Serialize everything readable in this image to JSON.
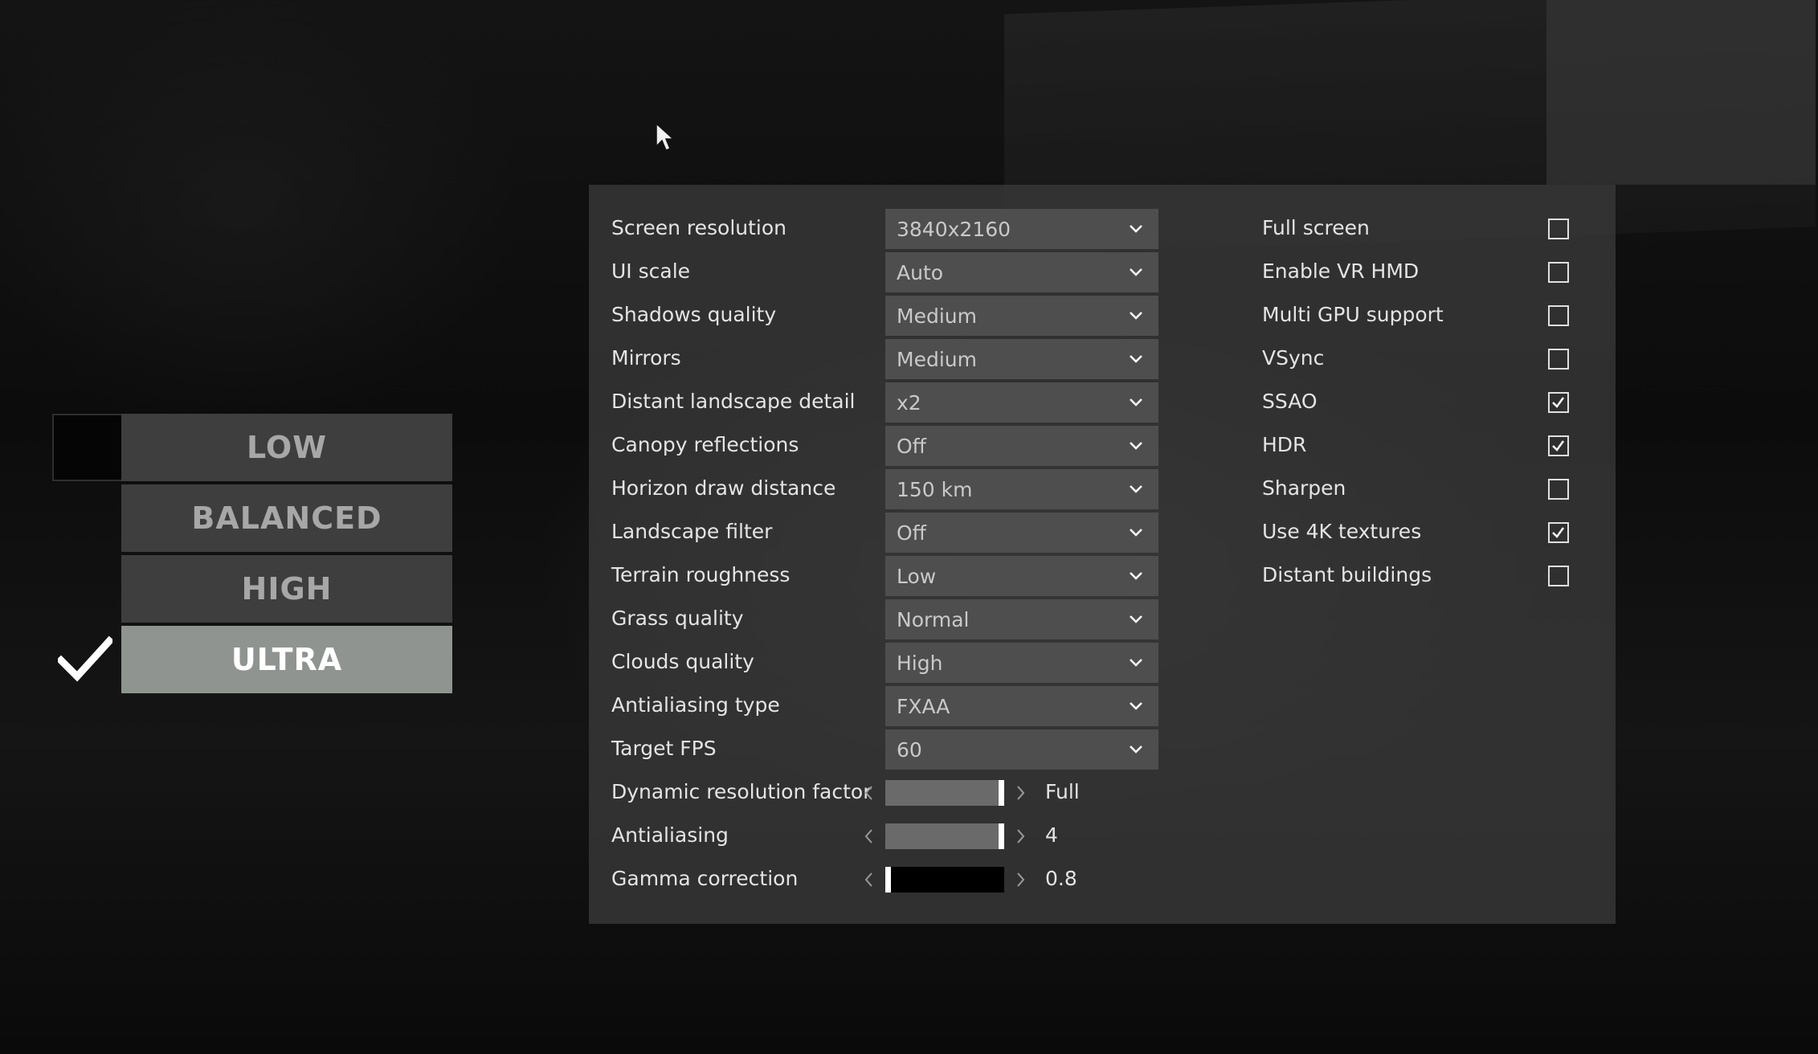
{
  "presets": {
    "items": [
      {
        "label": "LOW",
        "selected": false
      },
      {
        "label": "BALANCED",
        "selected": false
      },
      {
        "label": "HIGH",
        "selected": false
      },
      {
        "label": "ULTRA",
        "selected": true
      }
    ]
  },
  "dropdowns": [
    {
      "label": "Screen resolution",
      "value": "3840x2160"
    },
    {
      "label": "UI scale",
      "value": "Auto"
    },
    {
      "label": "Shadows quality",
      "value": "Medium"
    },
    {
      "label": "Mirrors",
      "value": "Medium"
    },
    {
      "label": "Distant landscape detail",
      "value": "x2"
    },
    {
      "label": "Canopy reflections",
      "value": "Off"
    },
    {
      "label": "Horizon draw distance",
      "value": "150 km"
    },
    {
      "label": "Landscape filter",
      "value": "Off"
    },
    {
      "label": "Terrain roughness",
      "value": "Low"
    },
    {
      "label": "Grass quality",
      "value": "Normal"
    },
    {
      "label": "Clouds quality",
      "value": "High"
    },
    {
      "label": "Antialiasing type",
      "value": "FXAA"
    },
    {
      "label": "Target FPS",
      "value": "60"
    }
  ],
  "sliders": [
    {
      "label": "Dynamic resolution factor",
      "value": "Full",
      "level": 1.0
    },
    {
      "label": "Antialiasing",
      "value": "4",
      "level": 1.0
    },
    {
      "label": "Gamma correction",
      "value": "0.8",
      "level": 0.0
    }
  ],
  "checkboxes": [
    {
      "label": "Full screen",
      "checked": false
    },
    {
      "label": "Enable VR HMD",
      "checked": false
    },
    {
      "label": "Multi GPU support",
      "checked": false
    },
    {
      "label": "VSync",
      "checked": false
    },
    {
      "label": "SSAO",
      "checked": true
    },
    {
      "label": "HDR",
      "checked": true
    },
    {
      "label": "Sharpen",
      "checked": false
    },
    {
      "label": "Use 4K textures",
      "checked": true
    },
    {
      "label": "Distant buildings",
      "checked": false
    }
  ],
  "colors": {
    "panel": "#3a3a3a",
    "preset_bg": "#3e3e3e",
    "preset_selected_bg": "#8f9490",
    "dropdown_bg": "#4e4e4e",
    "text": "#e4e4e4"
  },
  "icons": {
    "dropdown": "chevron-down-icon",
    "checkbox_on": "checkmark-icon",
    "preset_selected": "checkmark-icon",
    "slider_left": "chevron-left-icon",
    "slider_right": "chevron-right-icon",
    "cursor": "mouse-pointer-icon"
  }
}
